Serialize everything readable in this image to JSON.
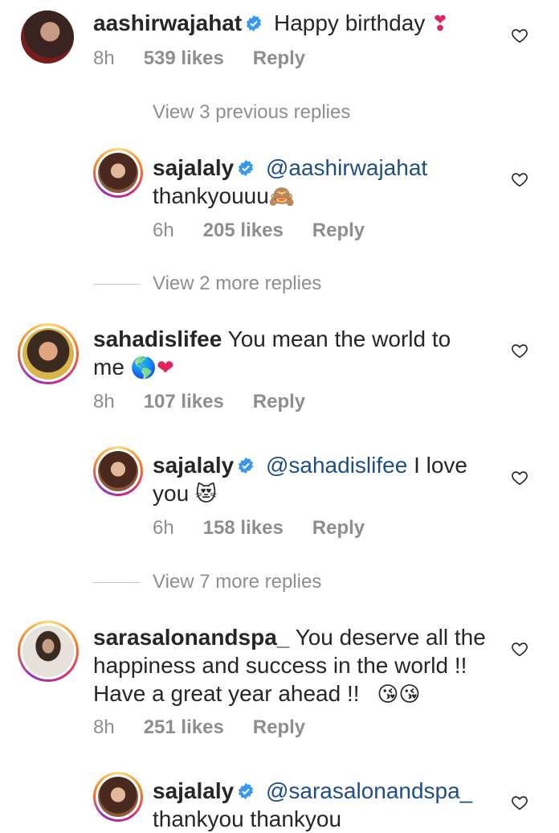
{
  "comments": [
    {
      "username": "aashirwajahat",
      "verified": true,
      "text": "Happy birthday",
      "emoji": "❣",
      "time": "8h",
      "likes": "539 likes",
      "reply": "Reply"
    },
    {
      "username": "sajalaly",
      "verified": true,
      "mention": "@aashirwajahat",
      "text": "thankyouuu",
      "emoji": "🙈",
      "time": "6h",
      "likes": "205 likes",
      "reply": "Reply"
    },
    {
      "username": "sahadislifee",
      "line1": "You mean the world to",
      "line2": "me",
      "emoji": "🌎❤",
      "time": "8h",
      "likes": "107 likes",
      "reply": "Reply"
    },
    {
      "username": "sajalaly",
      "verified": true,
      "mention": "@sahadislifee",
      "text_after_mention": "I love",
      "line2": "you",
      "emoji": "😻",
      "time": "6h",
      "likes": "158 likes",
      "reply": "Reply"
    },
    {
      "username": "sarasalonandspa_",
      "line1": "You deserve all the",
      "line2": "happiness and success in the world !!",
      "line3": "Have a great year ahead !!",
      "emoji": "😘😘",
      "time": "8h",
      "likes": "251 likes",
      "reply": "Reply"
    },
    {
      "username": "sajalaly",
      "verified": true,
      "mention": "@sarasalonandspa_",
      "line2": "thankyou thankyou"
    }
  ],
  "view_more": [
    "View 3 previous replies",
    "View 2 more replies",
    "View 7 more replies"
  ],
  "icons": {
    "like": "heart-outline-icon",
    "verified": "verified-badge-icon"
  },
  "colors": {
    "verified": "#3897f0",
    "mention": "#1d4e89",
    "meta": "#8e8e8e",
    "heart": "#262626"
  }
}
